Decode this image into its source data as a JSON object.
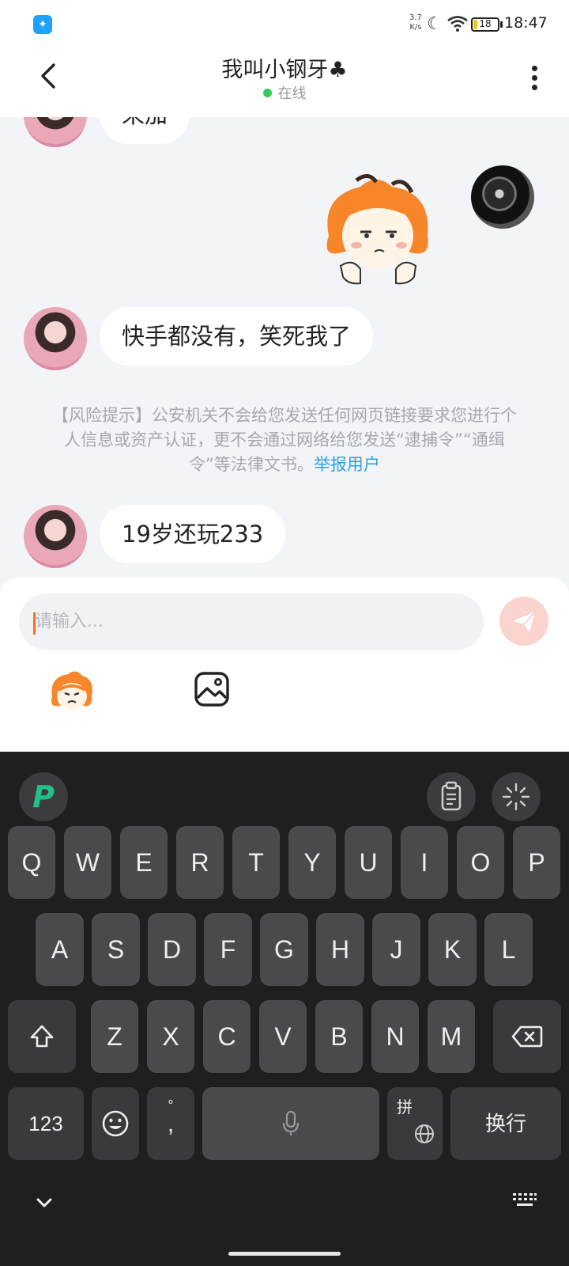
{
  "status_bar": {
    "net_speed_value": "3.7",
    "net_speed_unit": "K/s",
    "battery": "18",
    "battery_level": 0.18,
    "time": "18:47"
  },
  "header": {
    "title": "我叫小钢牙♣",
    "status": "在线"
  },
  "messages": [
    {
      "side": "left",
      "text": "来加"
    },
    {
      "side": "right",
      "type": "sticker"
    },
    {
      "side": "left",
      "text": "快手都没有，笑死我了"
    },
    {
      "side": "left",
      "text": "19岁还玩233"
    }
  ],
  "risk_notice": {
    "text": "【风险提示】公安机关不会给您发送任何网页链接要求您进行个人信息或资产认证，更不会通过网络给您发送“逮捕令”“通缉令”等法律文书。",
    "link": "举报用户"
  },
  "input": {
    "placeholder": "请输入..."
  },
  "keyboard": {
    "row1": [
      "Q",
      "W",
      "E",
      "R",
      "T",
      "Y",
      "U",
      "I",
      "O",
      "P"
    ],
    "row2": [
      "A",
      "S",
      "D",
      "F",
      "G",
      "H",
      "J",
      "K",
      "L"
    ],
    "row3": [
      "Z",
      "X",
      "C",
      "V",
      "B",
      "N",
      "M"
    ],
    "num_key": "123",
    "punct_key": "°,",
    "pinyin_key": "拼",
    "enter_key": "换行"
  },
  "colors": {
    "accent": "#ff6a2b",
    "link": "#2ba0e8",
    "online": "#2ecb5a"
  }
}
